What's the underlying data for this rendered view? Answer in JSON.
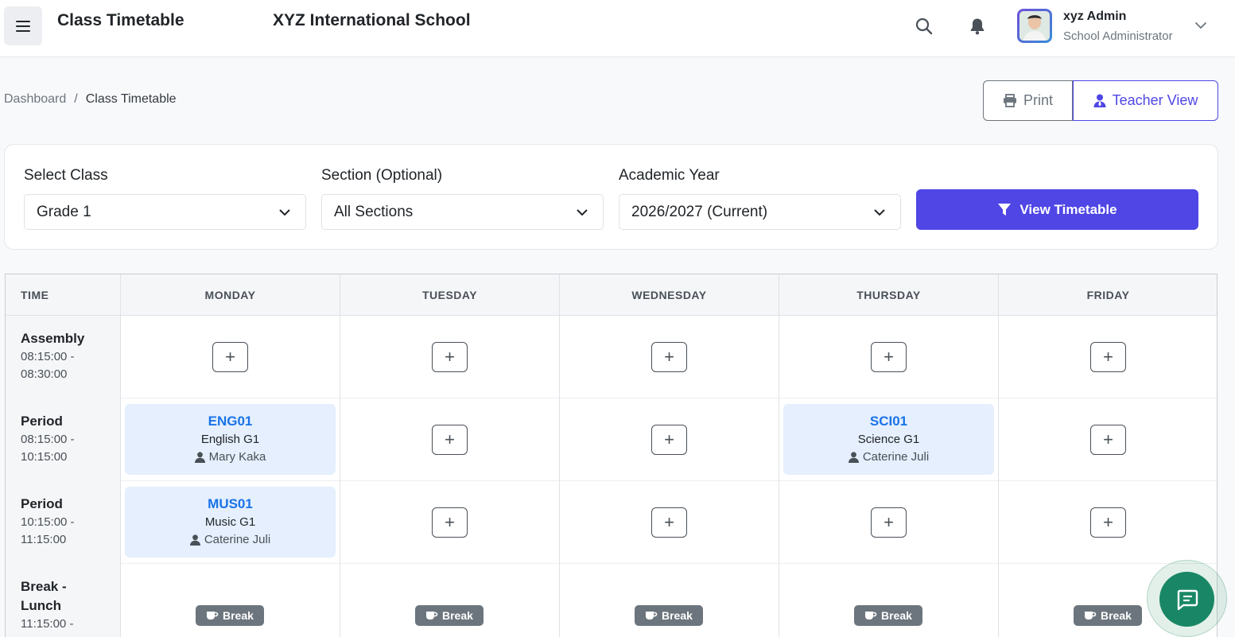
{
  "header": {
    "page_title": "Class Timetable",
    "school_name": "XYZ International School",
    "user": {
      "name": "xyz Admin",
      "role": "School Administrator"
    }
  },
  "breadcrumb": {
    "home": "Dashboard",
    "separator": "/",
    "current": "Class Timetable"
  },
  "actions": {
    "print_label": "Print",
    "teacher_view_label": "Teacher View"
  },
  "filters": {
    "class": {
      "label": "Select Class",
      "value": "Grade 1"
    },
    "section": {
      "label": "Section (Optional)",
      "value": "All Sections"
    },
    "year": {
      "label": "Academic Year",
      "value": "2026/2027 (Current)"
    },
    "submit_label": "View Timetable"
  },
  "timetable": {
    "headers": [
      "TIME",
      "MONDAY",
      "TUESDAY",
      "WEDNESDAY",
      "THURSDAY",
      "FRIDAY"
    ],
    "add_symbol": "+",
    "break_label": "Break",
    "rows": [
      {
        "name": "Assembly",
        "range": "08:15:00 - 08:30:00"
      },
      {
        "name": "Period",
        "range": "08:15:00 - 10:15:00"
      },
      {
        "name": "Period",
        "range": "10:15:00 - 11:15:00"
      },
      {
        "name": "Break - Lunch",
        "range": "11:15:00 -"
      }
    ],
    "lessons": {
      "eng": {
        "code": "ENG01",
        "subject": "English G1",
        "teacher": "Mary Kaka"
      },
      "sci": {
        "code": "SCI01",
        "subject": "Science G1",
        "teacher": "Caterine Juli"
      },
      "mus": {
        "code": "MUS01",
        "subject": "Music G1",
        "teacher": "Caterine Juli"
      }
    }
  },
  "colors": {
    "primary": "#4f46e5",
    "lesson_bg": "#e5effd",
    "lesson_code": "#1a73e8",
    "chat": "#198766"
  }
}
